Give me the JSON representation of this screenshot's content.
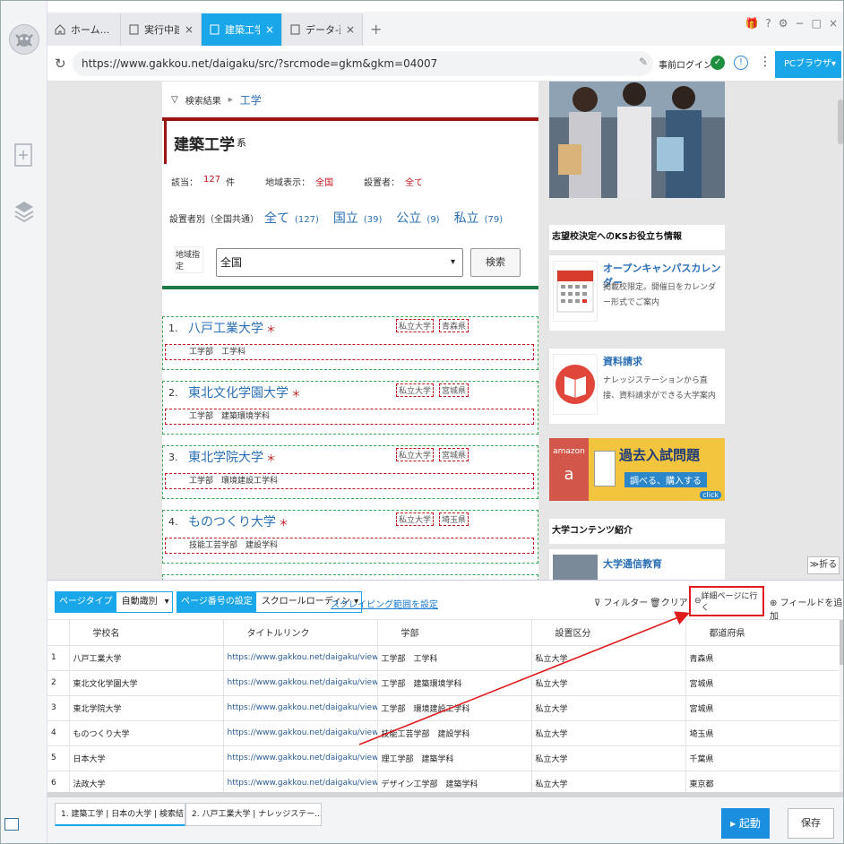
{
  "tabs": [
    {
      "label": "ホーム...",
      "icon": "home-icon"
    },
    {
      "label": "実行中建...",
      "icon": "page-icon"
    },
    {
      "label": "建築工学...",
      "icon": "page-icon"
    },
    {
      "label": "データ-建...",
      "icon": "page-icon"
    }
  ],
  "address": {
    "url": "https://www.gakkou.net/daigaku/src/?srcmode=gkm&gkm=04007",
    "prelogin": "事前ログイン",
    "pc_browser": "PCブラウザ"
  },
  "page": {
    "breadcrumb_1": "検索結果",
    "breadcrumb_2": "工学",
    "title": "建築工学",
    "title_suffix": "系",
    "stats": {
      "hit_label": "該当：",
      "hit_count": "127",
      "hit_unit": "件",
      "region_label": "地域表示：",
      "region_value": "全国",
      "founder_label": "設置者：",
      "founder_value": "全て"
    },
    "type_label": "設置者別（全国共通）",
    "types": [
      {
        "label": "全て",
        "count": "(127)"
      },
      {
        "label": "国立",
        "count": "(39)"
      },
      {
        "label": "公立",
        "count": "(9)"
      },
      {
        "label": "私立",
        "count": "(79)"
      }
    ],
    "region_box": "地域指定",
    "region_select": "全国",
    "search_button": "検索",
    "universities": [
      {
        "num": "1.",
        "name": "八戸工業大学",
        "star": "＊",
        "tag1": "私立大学",
        "tag2": "青森県",
        "faculty": "工学部　工学科"
      },
      {
        "num": "2.",
        "name": "東北文化学園大学",
        "star": "＊",
        "tag1": "私立大学",
        "tag2": "宮城県",
        "faculty": "工学部　建築環境学科"
      },
      {
        "num": "3.",
        "name": "東北学院大学",
        "star": "＊",
        "tag1": "私立大学",
        "tag2": "宮城県",
        "faculty": "工学部　環境建設工学科"
      },
      {
        "num": "4.",
        "name": "ものつくり大学",
        "star": "＊",
        "tag1": "私立大学",
        "tag2": "埼玉県",
        "faculty": "技能工芸学部　建設学科"
      }
    ]
  },
  "side": {
    "ks_header": "志望校決定へのKSお役立ち情報",
    "card1_title": "オープンキャンパスカレンダー",
    "card1_desc": "掲載校限定。開催日をカレンダー形式でご案内",
    "card2_title": "資料請求",
    "card2_desc": "ナレッジステーションから直接、資料請求ができる大学案内",
    "amazon_label": "amazon",
    "amazon_title": "過去入試問題",
    "amazon_sub": "調べる、購入する",
    "amazon_click": "click",
    "contents_header": "大学コンテンツ紹介",
    "card3_title": "大学通信教育",
    "fold": "折る"
  },
  "panel": {
    "page_type_label": "ページタイプ",
    "page_type_value": "自動識別",
    "page_num_label": "ページ番号の設定",
    "page_num_value": "スクロールローディン",
    "scrape_range": "スクレイピング範囲を設定",
    "filter": "フィルター",
    "clear": "クリア",
    "detail_page": "詳細ページに行く",
    "add_field": "フィールドを追加",
    "columns": [
      "",
      "学校名",
      "タイトルリンク",
      "学部",
      "設置区分",
      "都道府県"
    ],
    "rows": [
      [
        "1",
        "八戸工業大学",
        "https://www.gakkou.net/daigaku/view/div_10...",
        "工学部　工学科",
        "私立大学",
        "青森県"
      ],
      [
        "2",
        "東北文化学園大学",
        "https://www.gakkou.net/daigaku/view/div_10...",
        "工学部　建築環境学科",
        "私立大学",
        "宮城県"
      ],
      [
        "3",
        "東北学院大学",
        "https://www.gakkou.net/daigaku/view/div_10...",
        "工学部　環境建設工学科",
        "私立大学",
        "宮城県"
      ],
      [
        "4",
        "ものつくり大学",
        "https://www.gakkou.net/daigaku/view/div_10...",
        "技能工芸学部　建設学科",
        "私立大学",
        "埼玉県"
      ],
      [
        "5",
        "日本大学",
        "https://www.gakkou.net/daigaku/view/div_10...",
        "理工学部　建築学科",
        "私立大学",
        "千葉県"
      ],
      [
        "6",
        "法政大学",
        "https://www.gakkou.net/daigaku/view/div_10...",
        "デザイン工学部　建築学科",
        "私立大学",
        "東京都"
      ]
    ],
    "bottom_tab1": "1. 建築工学 | 日本の大学 | 検索結...",
    "bottom_tab2": "2. 八戸工業大学 | ナレッジステー...",
    "start": "起動",
    "save": "保存"
  },
  "colors": {
    "accent": "#1aa7ea",
    "red_line": "#9b1414",
    "green_line": "#1b7a45",
    "highlight": "#e01c1c"
  }
}
